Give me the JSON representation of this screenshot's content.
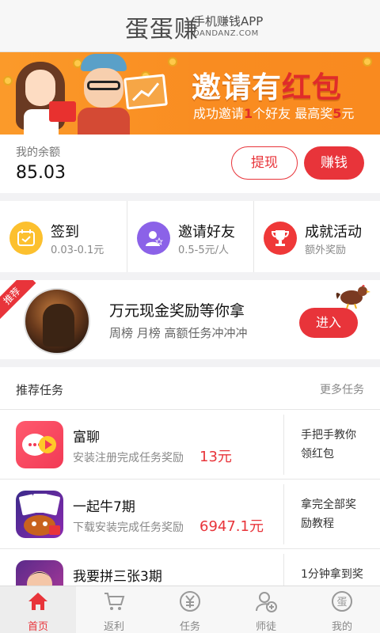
{
  "header": {
    "logo_main": "蛋蛋赚",
    "logo_sub": "手机赚钱APP",
    "logo_url": "DANDANZ.COM"
  },
  "banner": {
    "title_part1": "邀请有",
    "title_part2": "红包",
    "sub_part1": "成功邀请",
    "sub_num1": "1",
    "sub_part2": "个好友  最高奖",
    "sub_num2": "5",
    "sub_part3": "元"
  },
  "balance": {
    "label": "我的余额",
    "value": "85.03",
    "withdraw_label": "提现",
    "earn_label": "赚钱"
  },
  "features": [
    {
      "title": "签到",
      "desc": "0.03-0.1元",
      "icon": "calendar-check-icon",
      "color": "#fcc02e"
    },
    {
      "title": "邀请好友",
      "desc": "0.5-5元/人",
      "icon": "invite-user-icon",
      "color": "#8b62e8"
    },
    {
      "title": "成就活动",
      "desc": "额外奖励",
      "icon": "trophy-icon",
      "color": "#ef3838"
    }
  ],
  "promo": {
    "ribbon": "推荐",
    "title": "万元现金奖励等你拿",
    "subtitle": "周榜 月榜 高额任务冲冲冲",
    "button": "进入"
  },
  "tasks": {
    "title": "推荐任务",
    "more": "更多任务",
    "items": [
      {
        "name": "富聊",
        "desc": "安装注册完成任务奖励",
        "reward": "13元",
        "note": "手把手教你领红包"
      },
      {
        "name": "一起牛7期",
        "desc": "下载安装完成任务奖励",
        "reward": "6947.1元",
        "note": "拿完全部奖励教程"
      },
      {
        "name": "我要拼三张3期",
        "desc": "",
        "reward": "",
        "note": "1分钟拿到奖"
      }
    ]
  },
  "nav": [
    {
      "label": "首页",
      "icon": "home-icon",
      "active": true
    },
    {
      "label": "返利",
      "icon": "cart-icon",
      "active": false
    },
    {
      "label": "任务",
      "icon": "yen-coin-icon",
      "active": false
    },
    {
      "label": "师徒",
      "icon": "mentor-icon",
      "active": false
    },
    {
      "label": "我的",
      "icon": "profile-egg-icon",
      "active": false
    }
  ],
  "colors": {
    "accent": "#e8343a",
    "banner": "#f98c21"
  }
}
